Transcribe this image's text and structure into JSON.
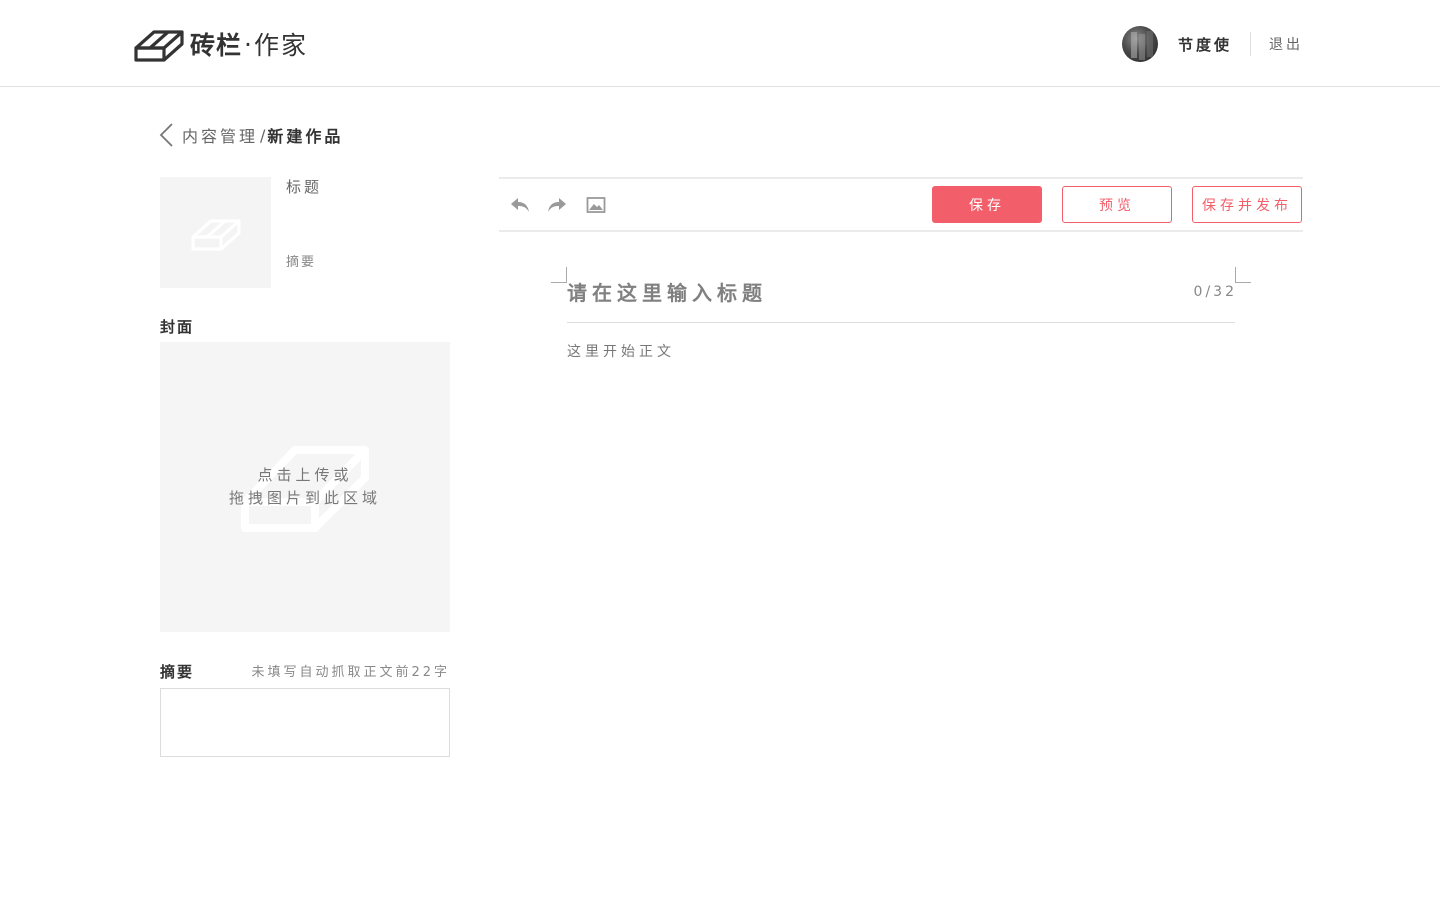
{
  "header": {
    "logo_brand": "砖栏",
    "logo_dot": "·",
    "logo_sub": "作家",
    "username": "节度使",
    "logout_label": "退出"
  },
  "breadcrumb": {
    "parent": "内容管理",
    "separator": "/",
    "current": "新建作品"
  },
  "preview": {
    "title": "标题",
    "summary": "摘要"
  },
  "cover": {
    "label": "封面",
    "hint_line1": "点击上传或",
    "hint_line2": "拖拽图片到此区域"
  },
  "summary": {
    "label": "摘要",
    "hint": "未填写自动抓取正文前22字",
    "value": ""
  },
  "toolbar": {
    "undo_icon": "undo-icon",
    "redo_icon": "redo-icon",
    "image_icon": "image-icon",
    "save_label": "保存",
    "preview_label": "预览",
    "publish_label": "保存并发布"
  },
  "editor": {
    "title_placeholder": "请在这里输入标题",
    "title_count": "0/32",
    "body_placeholder": "这里开始正文"
  },
  "colors": {
    "accent": "#f25e6a",
    "placeholder_bg": "#f5f5f5",
    "border": "#ebebeb"
  }
}
